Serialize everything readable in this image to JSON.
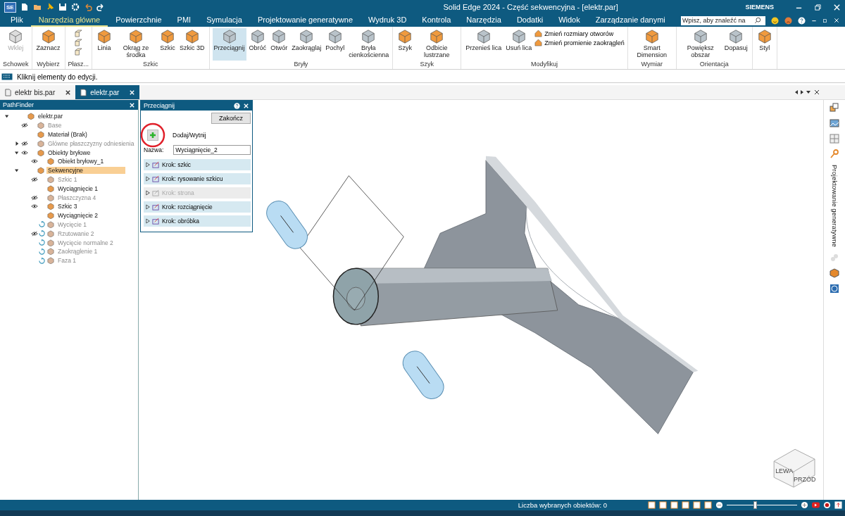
{
  "window": {
    "app_badge": "SE",
    "title": "Solid Edge 2024 - Część sekwencyjna - [elektr.par]",
    "brand": "SIEMENS"
  },
  "menu_tabs": [
    {
      "label": "Plik",
      "selected": false
    },
    {
      "label": "Narzędzia główne",
      "selected": true
    },
    {
      "label": "Powierzchnie",
      "selected": false
    },
    {
      "label": "PMI",
      "selected": false
    },
    {
      "label": "Symulacja",
      "selected": false
    },
    {
      "label": "Projektowanie generatywne",
      "selected": false
    },
    {
      "label": "Wydruk 3D",
      "selected": false
    },
    {
      "label": "Kontrola",
      "selected": false
    },
    {
      "label": "Narzędzia",
      "selected": false
    },
    {
      "label": "Dodatki",
      "selected": false
    },
    {
      "label": "Widok",
      "selected": false
    },
    {
      "label": "Zarządzanie danymi",
      "selected": false
    }
  ],
  "search": {
    "placeholder": "Wpisz, aby znaleźć na"
  },
  "ribbon": {
    "groups": [
      {
        "label": "Schowek",
        "commands": [
          {
            "label": "Wklej",
            "active": false,
            "disabled": true
          }
        ]
      },
      {
        "label": "Wybierz",
        "commands": [
          {
            "label": "Zaznacz",
            "active": false,
            "disabled": false
          }
        ]
      },
      {
        "label": "Płasz..."
      },
      {
        "label": "Szkic",
        "commands": [
          {
            "label": "Linia",
            "active": false,
            "disabled": false
          },
          {
            "label": "Okrąg ze środka",
            "active": false,
            "disabled": false
          },
          {
            "label": "Szkic",
            "active": false,
            "disabled": false
          },
          {
            "label": "Szkic 3D",
            "active": false,
            "disabled": false
          }
        ]
      },
      {
        "label": "Bryły",
        "commands": [
          {
            "label": "Przeciągnij",
            "active": true,
            "disabled": false
          },
          {
            "label": "Obróć",
            "active": false,
            "disabled": false
          },
          {
            "label": "Otwór",
            "active": false,
            "disabled": false
          },
          {
            "label": "Zaokrąglaj",
            "active": false,
            "disabled": false
          },
          {
            "label": "Pochyl",
            "active": false,
            "disabled": false
          },
          {
            "label": "Bryła cienkościenna",
            "active": false,
            "disabled": false
          }
        ]
      },
      {
        "label": "Szyk",
        "commands": [
          {
            "label": "Szyk",
            "active": false,
            "disabled": false
          },
          {
            "label": "Odbicie lustrzane",
            "active": false,
            "disabled": false
          }
        ]
      },
      {
        "label": "Modyfikuj",
        "commands": [
          {
            "label": "Przenieś lica",
            "active": false,
            "disabled": false
          },
          {
            "label": "Usuń lica",
            "active": false,
            "disabled": false
          }
        ],
        "small_commands": [
          "Zmień rozmiary otworów",
          "Zmień promienie zaokrągleń"
        ]
      },
      {
        "label": "Wymiar",
        "commands": [
          {
            "label": "Smart Dimension",
            "active": false,
            "disabled": false
          }
        ]
      },
      {
        "label": "Orientacja",
        "commands": [
          {
            "label": "Powiększ obszar",
            "active": false,
            "disabled": false
          },
          {
            "label": "Dopasuj",
            "active": false,
            "disabled": false
          }
        ]
      },
      {
        "commands": [
          {
            "label": "Styl",
            "active": false,
            "disabled": false
          }
        ]
      }
    ]
  },
  "command_bar": {
    "prompt": "Kliknij elementy do edycji."
  },
  "doc_tabs": [
    {
      "label": "elektr bis.par",
      "selected": false
    },
    {
      "label": "elektr.par",
      "selected": true
    }
  ],
  "pathfinder": {
    "title": "PathFinder",
    "tree": [
      {
        "label": "elektr.par",
        "dimmed": false,
        "rolled_back": false,
        "selected": false,
        "expanded": true,
        "children": [
          {
            "label": "Base",
            "visible": false,
            "dimmed": true,
            "rolled_back": false,
            "selected": false
          },
          {
            "label": "Materiał (Brak)",
            "dimmed": false,
            "rolled_back": false,
            "selected": false
          },
          {
            "label": "Główne płaszczyzny odniesienia",
            "visible": false,
            "dimmed": true,
            "rolled_back": false,
            "selected": false,
            "expanded": false
          },
          {
            "label": "Obiekty bryłowe",
            "visible": true,
            "dimmed": false,
            "rolled_back": false,
            "selected": false,
            "expanded": true,
            "children": [
              {
                "label": "Obiekt bryłowy_1",
                "visible": true,
                "dimmed": false,
                "rolled_back": false,
                "selected": false
              }
            ]
          },
          {
            "label": "Sekwencyjne",
            "dimmed": false,
            "rolled_back": false,
            "selected": true,
            "expanded": true,
            "children": [
              {
                "label": "Szkic 1",
                "visible": false,
                "dimmed": true,
                "rolled_back": false,
                "selected": false
              },
              {
                "label": "Wyciągnięcie 1",
                "dimmed": false,
                "rolled_back": false,
                "selected": false
              },
              {
                "label": "Płaszczyzna 4",
                "visible": false,
                "dimmed": true,
                "rolled_back": false,
                "selected": false
              },
              {
                "label": "Szkic 3",
                "visible": true,
                "dimmed": false,
                "rolled_back": false,
                "selected": false
              },
              {
                "label": "Wyciągnięcie 2",
                "dimmed": false,
                "rolled_back": false,
                "selected": false
              },
              {
                "label": "Wycięcie 1",
                "dimmed": true,
                "rolled_back": true,
                "selected": false
              },
              {
                "label": "Rzutowanie 2",
                "visible": false,
                "dimmed": true,
                "rolled_back": true,
                "selected": false
              },
              {
                "label": "Wycięcie normalne 2",
                "dimmed": true,
                "rolled_back": true,
                "selected": false
              },
              {
                "label": "Zaokrąglenie 1",
                "dimmed": true,
                "rolled_back": true,
                "selected": false
              },
              {
                "label": "Faza 1",
                "dimmed": true,
                "rolled_back": true,
                "selected": false
              }
            ]
          }
        ]
      }
    ]
  },
  "command_panel": {
    "title": "Przeciągnij",
    "finish_button": "Zakończ",
    "mode_label": "Dodaj/Wytnij",
    "name_label": "Nazwa:",
    "name_value": "Wyciągnięcie_2",
    "steps": [
      {
        "label": "Krok: szkic",
        "disabled": false
      },
      {
        "label": "Krok: rysowanie szkicu",
        "disabled": false
      },
      {
        "label": "Krok: strona",
        "disabled": true
      },
      {
        "label": "Krok: rozciągnięcie",
        "disabled": false
      },
      {
        "label": "Krok: obróbka",
        "disabled": false
      }
    ]
  },
  "view_cube": {
    "faces": [
      "LEWA",
      "PRZÓD"
    ]
  },
  "right_strip": {
    "label": "Projektowanie generatywne"
  },
  "status_bar": {
    "selection": "Liczba wybranych obiektów: 0",
    "zoom": {
      "level": 0.4
    }
  }
}
